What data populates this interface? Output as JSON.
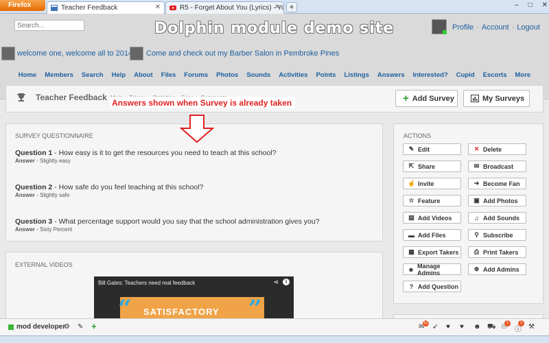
{
  "browser": {
    "app_button": "Firefox",
    "tabs": [
      {
        "title": "Teacher Feedback"
      },
      {
        "title": "R5 - Forget About You (Lyrics) - Yo..."
      }
    ],
    "new_tab": "+",
    "controls": [
      "–",
      "□",
      "✕"
    ]
  },
  "header": {
    "search_placeholder": "Search...",
    "site_title": "Dolphin module demo site",
    "account_links": [
      "Profile",
      "Account",
      "Logout"
    ]
  },
  "status": [
    {
      "text": "welcome one, welcome all to 2014"
    },
    {
      "text": "Come and check out my Barber Salon in Pembroke Pines"
    }
  ],
  "nav": [
    "Home",
    "Members",
    "Search",
    "Help",
    "About",
    "Files",
    "Forums",
    "Photos",
    "Sounds",
    "Activities",
    "Points",
    "Listings",
    "Answers",
    "Interested?",
    "Cupid",
    "Escorts",
    "More"
  ],
  "page": {
    "title": "Teacher Feedback",
    "sub_tabs": [
      "Main",
      "Takers",
      "Statistics",
      "Fans",
      "Comments"
    ],
    "add_survey": "Add Survey",
    "my_surveys": "My Surveys",
    "annotation": "Answers shown when Survey is already taken"
  },
  "survey": {
    "heading": "SURVEY QUESTIONNAIRE",
    "questions": [
      {
        "label": "Question 1",
        "text": " - How easy is it to get the resources you need to teach at this school?",
        "answer_label": "Answer",
        "answer": " - Slightly easy"
      },
      {
        "label": "Question 2",
        "text": " - How safe do you feel teaching at this school?",
        "answer_label": "Answer",
        "answer": " - Slightly safe"
      },
      {
        "label": "Question 3",
        "text": " - What percentage support would you say that the school administration gives you?",
        "answer_label": "Answer",
        "answer": " - Sixty Percent"
      }
    ]
  },
  "videos": {
    "heading": "EXTERNAL VIDEOS",
    "title": "Bill Gates: Teachers need real feedback",
    "sign_text": "SATISFACTORY"
  },
  "actions": {
    "heading": "ACTIONS",
    "items": [
      {
        "label": "Edit",
        "icon": "edit-icon"
      },
      {
        "label": "Delete",
        "icon": "delete-icon"
      },
      {
        "label": "Share",
        "icon": "share-icon"
      },
      {
        "label": "Broadcast",
        "icon": "broadcast-icon"
      },
      {
        "label": "Invite",
        "icon": "invite-icon"
      },
      {
        "label": "Become Fan",
        "icon": "become-fan-icon"
      },
      {
        "label": "Feature",
        "icon": "star-icon"
      },
      {
        "label": "Add Photos",
        "icon": "photo-icon"
      },
      {
        "label": "Add Videos",
        "icon": "video-icon"
      },
      {
        "label": "Add Sounds",
        "icon": "music-icon"
      },
      {
        "label": "Add Files",
        "icon": "file-icon"
      },
      {
        "label": "Subscribe",
        "icon": "subscribe-icon"
      },
      {
        "label": "Export Takers",
        "icon": "export-icon"
      },
      {
        "label": "Print Takers",
        "icon": "print-icon"
      },
      {
        "label": "Manage Admins",
        "icon": "users-icon"
      },
      {
        "label": "Add Admins",
        "icon": "add-admin-icon"
      },
      {
        "label": "Add Question",
        "icon": "question-icon"
      }
    ]
  },
  "bottom_bar": {
    "user_label": "mod developer",
    "badges": [
      "12",
      "1",
      "1"
    ]
  }
}
